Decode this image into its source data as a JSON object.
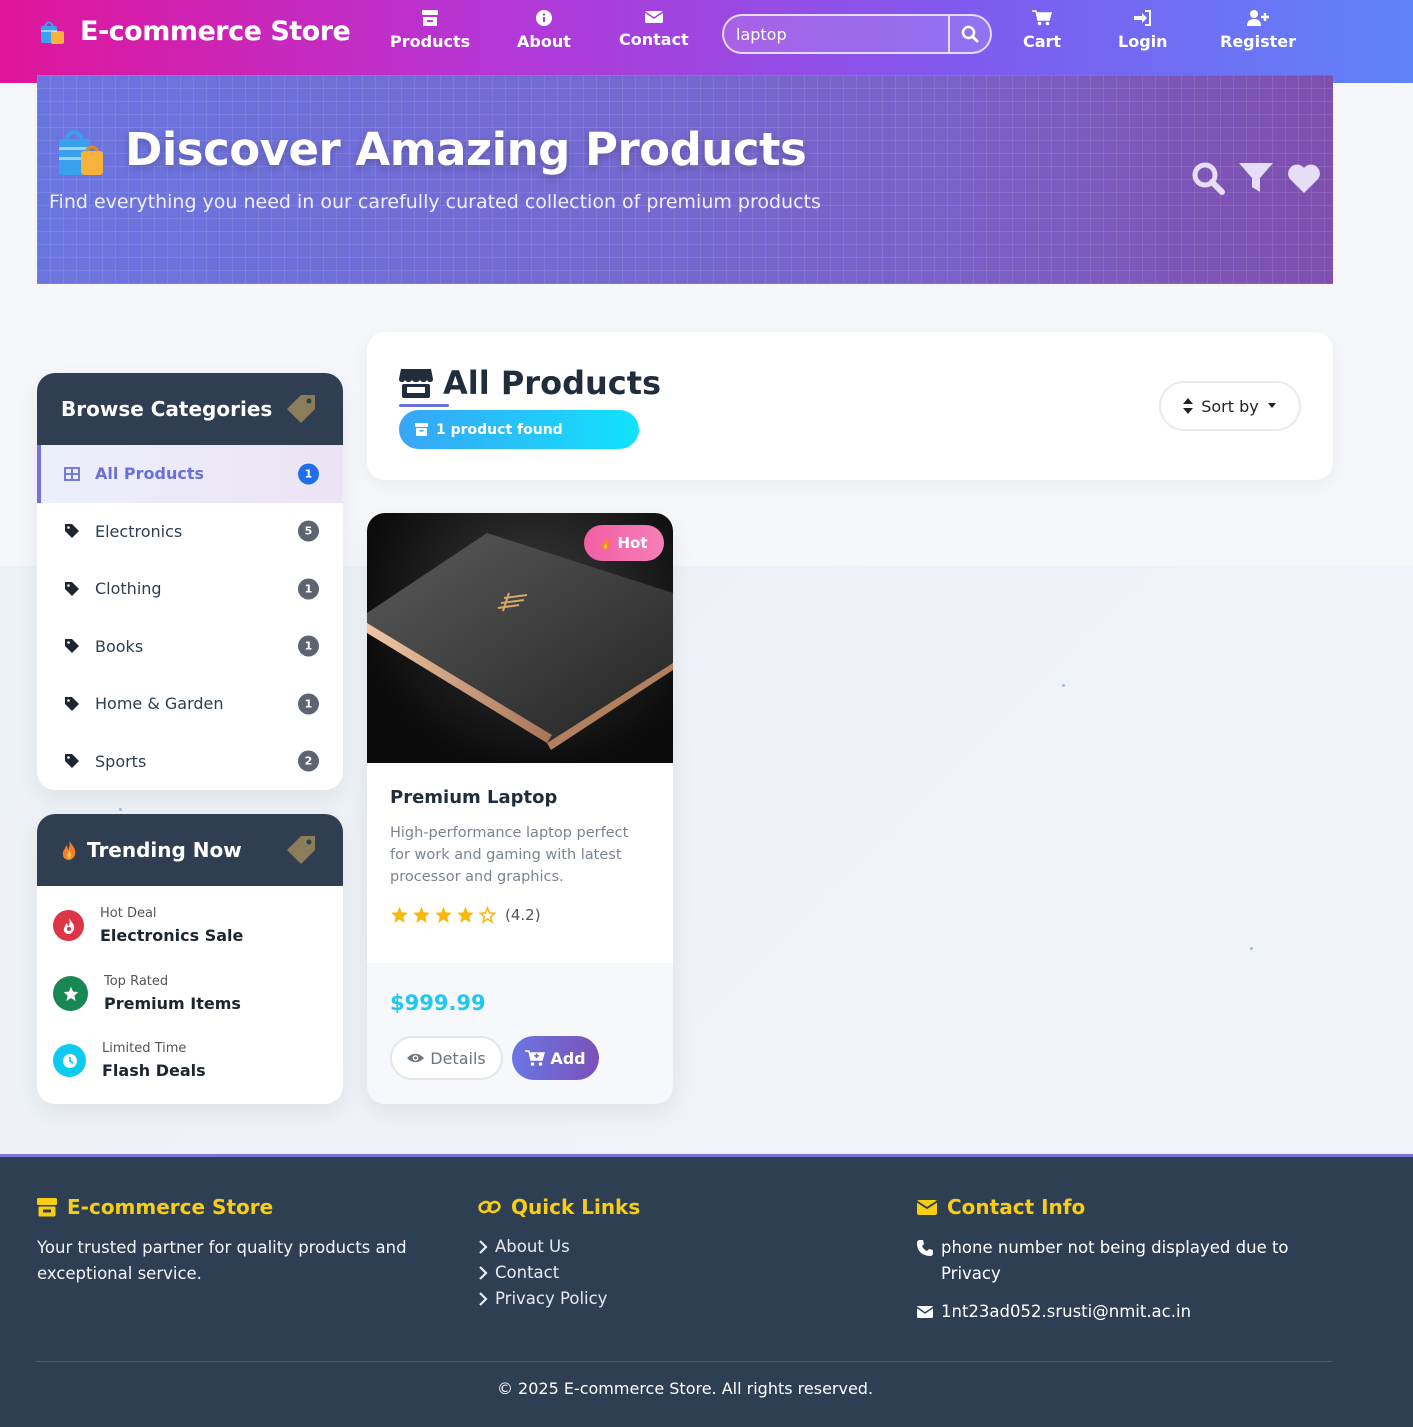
{
  "nav": {
    "brand": "E-commerce Store",
    "items": [
      {
        "label": "Products",
        "icon": "store-icon"
      },
      {
        "label": "About",
        "icon": "info-icon"
      },
      {
        "label": "Contact",
        "icon": "envelope-icon"
      },
      {
        "label": "Cart",
        "icon": "cart-icon"
      },
      {
        "label": "Login",
        "icon": "sign-in-icon"
      },
      {
        "label": "Register",
        "icon": "user-plus-icon"
      }
    ],
    "search": {
      "value": "laptop",
      "placeholder": ""
    }
  },
  "hero": {
    "title": "Discover Amazing Products",
    "subtitle": "Find everything you need in our carefully curated collection of premium products"
  },
  "categories": {
    "title": "Browse Categories",
    "items": [
      {
        "label": "All Products",
        "count": "1",
        "active": true
      },
      {
        "label": "Electronics",
        "count": "5"
      },
      {
        "label": "Clothing",
        "count": "1"
      },
      {
        "label": "Books",
        "count": "1"
      },
      {
        "label": "Home & Garden",
        "count": "1"
      },
      {
        "label": "Sports",
        "count": "2"
      }
    ]
  },
  "trending": {
    "title": "Trending Now",
    "items": [
      {
        "kicker": "Hot Deal",
        "label": "Electronics Sale",
        "color": "#dc3545"
      },
      {
        "kicker": "Top Rated",
        "label": "Premium Items",
        "color": "#198754"
      },
      {
        "kicker": "Limited Time",
        "label": "Flash Deals",
        "color": "#0dcaf0"
      }
    ]
  },
  "products_header": {
    "title": "All Products",
    "count_label": "1 product found",
    "sort_label": "Sort by"
  },
  "products": [
    {
      "badge": "Hot",
      "name": "Premium Laptop",
      "description": "High-performance laptop perfect for work and gaming with latest processor and graphics.",
      "rating": 4.2,
      "rating_label": "(4.2)",
      "price": "$999.99",
      "details_label": "Details",
      "add_label": "Add"
    }
  ],
  "footer": {
    "brand": "E-commerce Store",
    "tagline": "Your trusted partner for quality products and exceptional service.",
    "quick_links_title": "Quick Links",
    "links": [
      "About Us",
      "Contact",
      "Privacy Policy"
    ],
    "contact_title": "Contact Info",
    "phone": "phone number not being displayed due to Privacy",
    "email": "1nt23ad052.srusti@nmit.ac.in",
    "copyright": "© 2025 E-commerce Store. All rights reserved."
  },
  "colors": {
    "accent": "#6a6fd6",
    "price": "#22c7ef",
    "footer_heading": "#f8ce12",
    "sidebar_head": "#2f3e50"
  }
}
